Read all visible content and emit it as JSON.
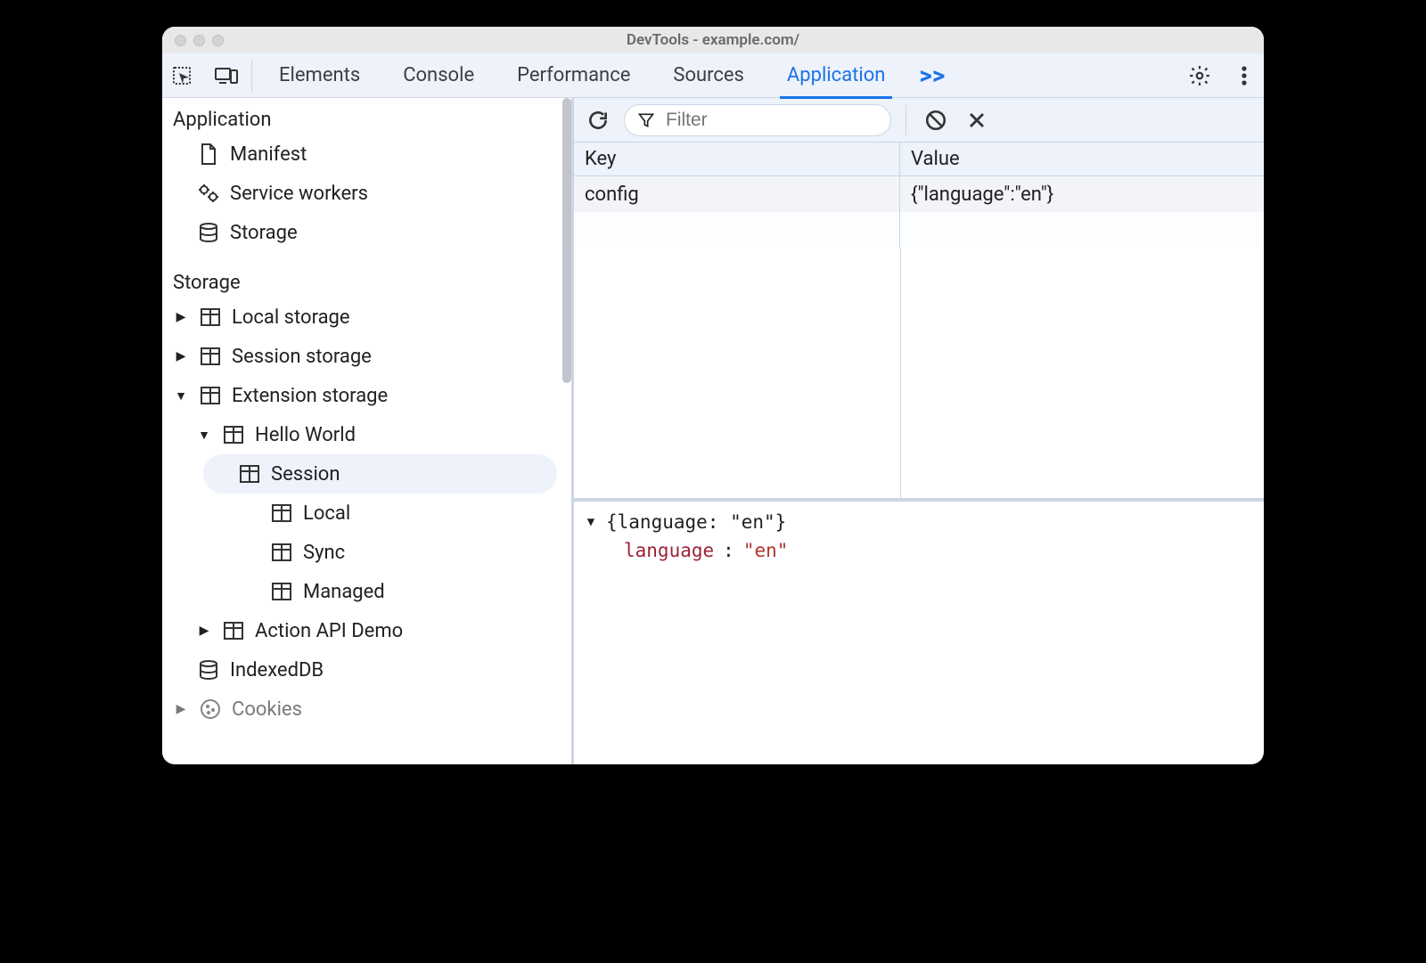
{
  "window": {
    "title": "DevTools - example.com/"
  },
  "tabs": {
    "items": [
      "Elements",
      "Console",
      "Performance",
      "Sources",
      "Application"
    ],
    "active_index": 4,
    "overflow": ">>"
  },
  "sidebar": {
    "sections": {
      "application": {
        "label": "Application",
        "items": [
          {
            "icon": "document",
            "label": "Manifest"
          },
          {
            "icon": "gears",
            "label": "Service workers"
          },
          {
            "icon": "database",
            "label": "Storage"
          }
        ]
      },
      "storage": {
        "label": "Storage",
        "items": [
          {
            "arrow": "right",
            "icon": "table",
            "label": "Local storage"
          },
          {
            "arrow": "right",
            "icon": "table",
            "label": "Session storage"
          },
          {
            "arrow": "down",
            "icon": "table",
            "label": "Extension storage",
            "children": [
              {
                "arrow": "down",
                "icon": "table",
                "label": "Hello World",
                "children": [
                  {
                    "icon": "table",
                    "label": "Session",
                    "selected": true
                  },
                  {
                    "icon": "table",
                    "label": "Local"
                  },
                  {
                    "icon": "table",
                    "label": "Sync"
                  },
                  {
                    "icon": "table",
                    "label": "Managed"
                  }
                ]
              },
              {
                "arrow": "right",
                "icon": "table",
                "label": "Action API Demo"
              }
            ]
          },
          {
            "icon": "database",
            "label": "IndexedDB"
          },
          {
            "arrow": "right",
            "icon": "cookie",
            "label": "Cookies"
          }
        ]
      }
    }
  },
  "toolbar": {
    "filter_placeholder": "Filter"
  },
  "table": {
    "columns": [
      "Key",
      "Value"
    ],
    "rows": [
      {
        "key": "config",
        "value": "{\"language\":\"en\"}"
      }
    ]
  },
  "preview": {
    "summary": "{language: \"en\"}",
    "prop_key": "language",
    "prop_sep": ":",
    "prop_value": "\"en\""
  }
}
